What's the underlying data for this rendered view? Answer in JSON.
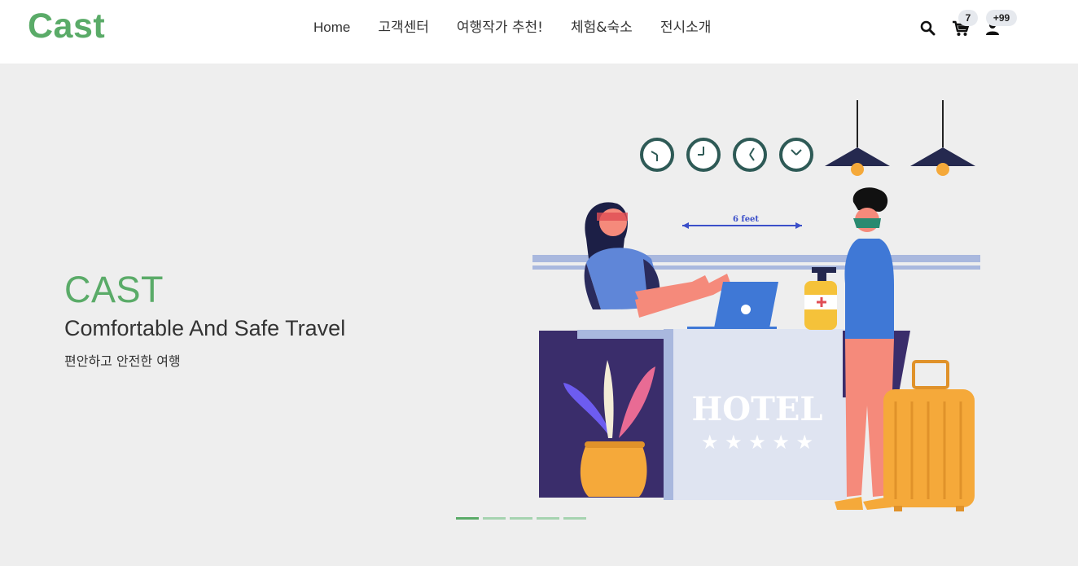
{
  "header": {
    "logo": "Cast",
    "nav": [
      "Home",
      "고객센터",
      "여행작가 추천!",
      "체험&숙소",
      "전시소개"
    ],
    "cart_count": "7",
    "user_count": "+99",
    "icons": [
      "search-icon",
      "cart-icon",
      "user-icon"
    ]
  },
  "hero": {
    "title": "CAST",
    "subtitle": "Comfortable And Safe Travel",
    "tagline": "편안하고 안전한 여행",
    "illustration": {
      "distance_label": "6 feet",
      "sign": "HOTEL",
      "stars": "★ ★ ★ ★ ★"
    },
    "slider": {
      "slides": 5,
      "active": 1
    }
  },
  "colors": {
    "brand": "#5aab68",
    "hero_bg": "#eeeeee",
    "dot": "#a6d3b0"
  }
}
